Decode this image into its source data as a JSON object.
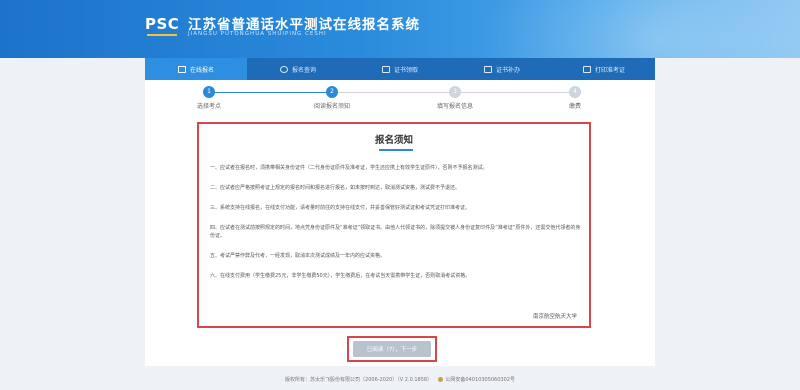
{
  "header": {
    "logo_text": "PSC",
    "title": "江苏省普通话水平测试在线报名系统",
    "subtitle": "JIANGSU PUTONGHUA SHUIPING CESHI"
  },
  "nav": {
    "items": [
      {
        "label": "在线报名",
        "icon": "edit-icon"
      },
      {
        "label": "报名查询",
        "icon": "search-icon"
      },
      {
        "label": "证书领取",
        "icon": "certificate-icon"
      },
      {
        "label": "证书补办",
        "icon": "certificate-reissue-icon"
      },
      {
        "label": "打印准考证",
        "icon": "printer-icon"
      }
    ]
  },
  "steps": [
    {
      "num": "1",
      "label": "选择考点",
      "done": true
    },
    {
      "num": "2",
      "label": "阅读报名须知",
      "done": true
    },
    {
      "num": "3",
      "label": "填写报名信息",
      "done": false
    },
    {
      "num": "4",
      "label": "缴费",
      "done": false
    }
  ],
  "notice": {
    "title": "报名须知",
    "paragraphs": [
      "一、应试者在报名时，须携带相关身份证件（二代身份证原件及准考证，学生还应携上有效学生证原件），否则不予报名测试。",
      "二、应试者应严格按照考证上规定的报名时间和报名进行报名，如未按时到达，取消测试资格，测试费不予退还。",
      "三、系统支持在线报名，在线支付功能，请考量时前往的支持在线支付，并妥善保管好测试证和考试凭证打印准考证。",
      "四、应试者在测试前按照规定的时间，地点凭身份证原件及“准考证”领取证书。由他人代领证书的，除须提交被人身份证复印件及“准考证”原件外，还需交他代领者的身份证。",
      "五、考试严禁作弊及代考，一经发现，取消本次测试成绩及一年内的应试资格。",
      "六、在线支付费用（学生缴费25元，非学生缴费50元），学生缴费后，在考试当天需携带学生证，否则取消考试资格。"
    ],
    "signature": "南京航空航天大学"
  },
  "next_button": {
    "label": "已阅读（7），下一步"
  },
  "footer": {
    "copyright": "版权所有：苏太乐飞股份有限公司（2006-2020）（V 2.0.1858）",
    "police_record": "公网安备04010305060302号"
  },
  "colors": {
    "primary": "#2b8ad8",
    "nav": "#1f6bb8",
    "highlight_border": "#d9454a"
  }
}
